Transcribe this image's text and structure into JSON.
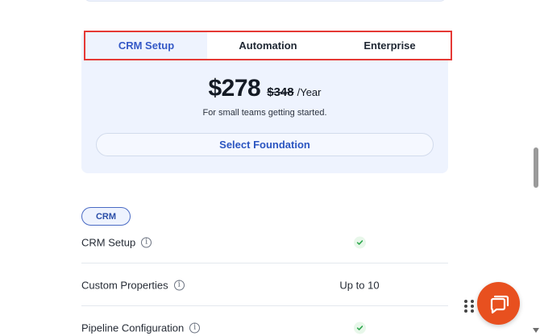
{
  "tabs": [
    {
      "label": "CRM Setup",
      "active": true
    },
    {
      "label": "Automation",
      "active": false
    },
    {
      "label": "Enterprise",
      "active": false
    }
  ],
  "pricing": {
    "price": "$278",
    "old_price": "$348",
    "period": "/Year",
    "subtitle": "For small teams getting started.",
    "cta_label": "Select Foundation"
  },
  "section_badge": "CRM",
  "features": [
    {
      "name": "CRM Setup",
      "value": "",
      "value_icon": "check-icon"
    },
    {
      "name": "Custom Properties",
      "value": "Up to 10",
      "value_icon": ""
    },
    {
      "name": "Pipeline Configuration",
      "value": "",
      "value_icon": "check-icon"
    }
  ],
  "icons": {
    "info": "info-icon",
    "check": "check-icon",
    "chat": "chat-icon",
    "drag": "drag-handle-icon"
  },
  "colors": {
    "accent": "#2b55c0",
    "card_bg": "#eef3fe",
    "tab_highlight_border": "#e53935",
    "chat_button": "#e8501f",
    "check": "#2fa84f"
  }
}
